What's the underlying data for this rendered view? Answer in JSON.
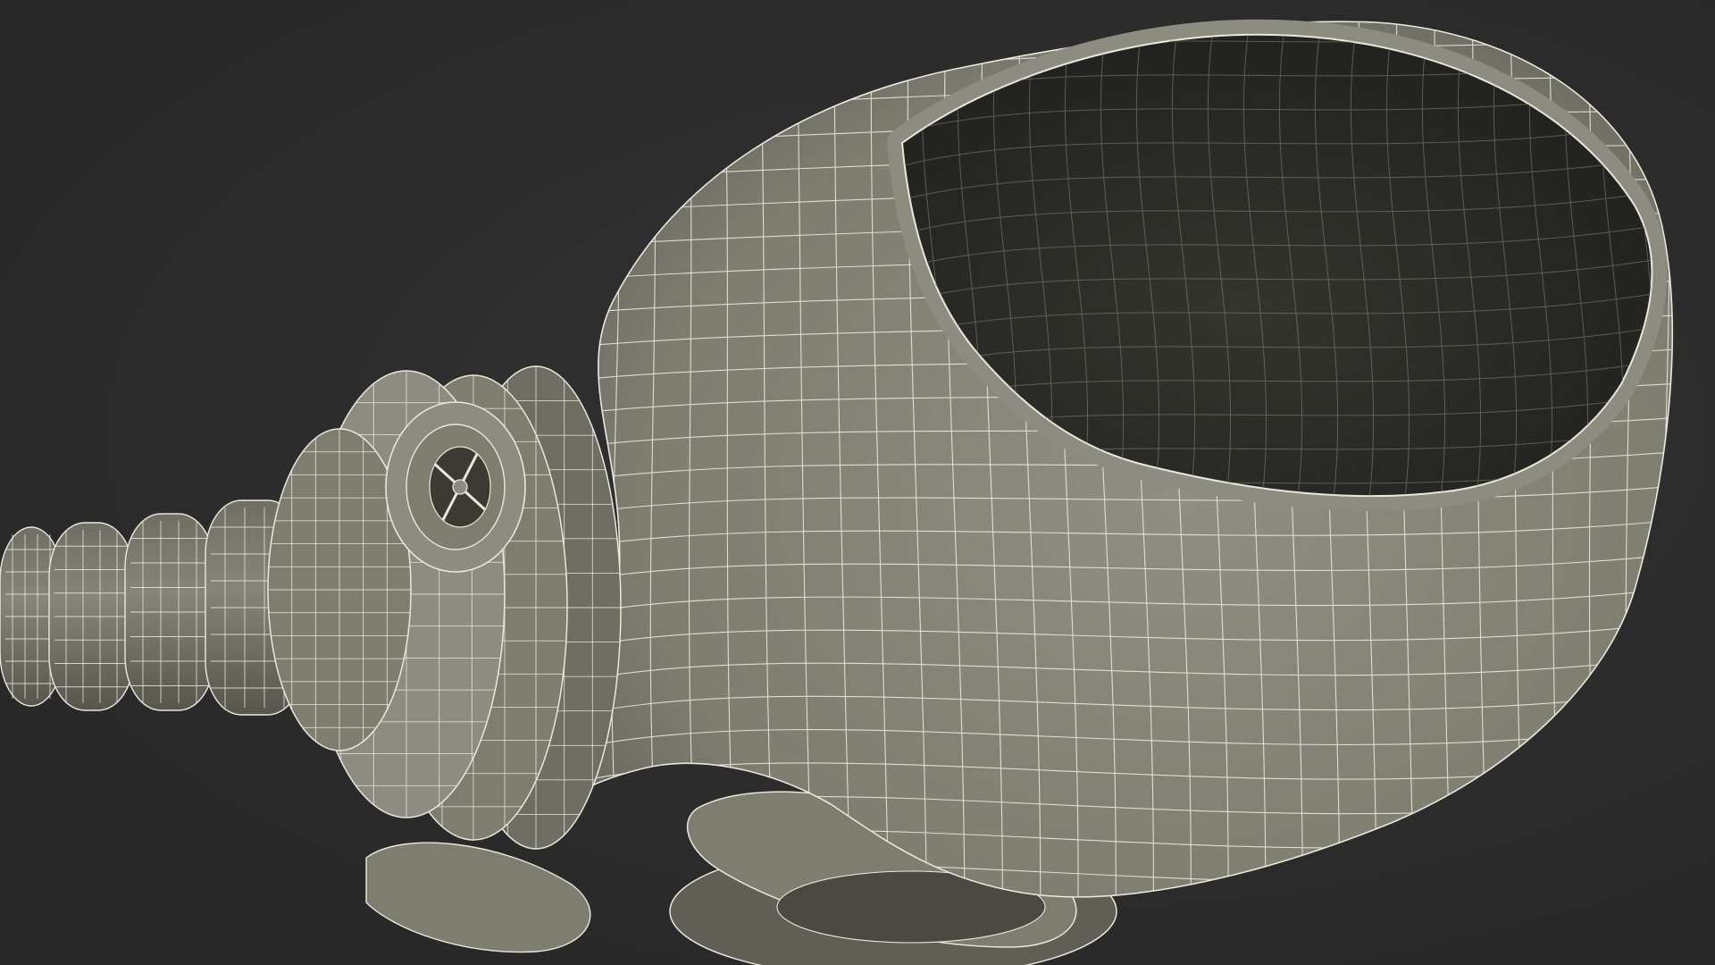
{
  "scene": {
    "subject": "wireframe-gas-mask-model",
    "colors": {
      "background": "#2c2c2c",
      "surface": "#7d7d70",
      "surface_light": "#8c8c80",
      "surface_dark": "#5f5f55",
      "interior": "#262624",
      "interior_mid": "#33332f",
      "wire": "#e9e8dc"
    },
    "parts": [
      "mask-body",
      "eye-opening",
      "filter-canister",
      "valve-cap",
      "breathing-hose",
      "side-valve"
    ]
  }
}
